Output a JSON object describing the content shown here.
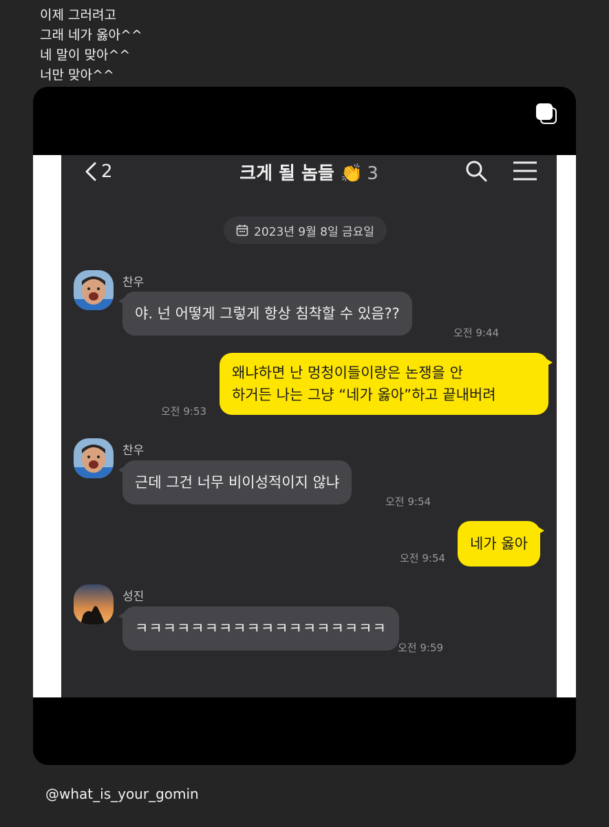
{
  "caption": {
    "lines": [
      "이제 그러려고",
      "그래 네가 옳아^^",
      "네 말이 맞아^^",
      "너만 맞아^^"
    ]
  },
  "chat": {
    "back_count": "2",
    "title": "크게 될 놈들 👏",
    "member_count": "3",
    "date": "2023년 9월 8일 금요일",
    "messages": [
      {
        "sender": "찬우",
        "text": "야. 넌 어떻게 그렇게 항상 침착할 수 있음??",
        "time": "오전 9:44",
        "direction": "in"
      },
      {
        "text_line1": "왜냐하면 난 멍청이들이랑은 논쟁을 안",
        "text_line2": "하거든 나는 그냥 “네가 옳아”하고 끝내버려",
        "time": "오전 9:53",
        "direction": "out"
      },
      {
        "sender": "찬우",
        "text": "근데 그건 너무 비이성적이지 않냐",
        "time": "오전 9:54",
        "direction": "in"
      },
      {
        "text": "네가 옳아",
        "time": "오전 9:54",
        "direction": "out"
      },
      {
        "sender": "성진",
        "text": "ㅋㅋㅋㅋㅋㅋㅋㅋㅋㅋㅋㅋㅋㅋㅋㅋㅋㅋ",
        "time": "오전 9:59",
        "direction": "in"
      }
    ]
  },
  "handle": "@what_is_your_gomin",
  "icons": [
    "multiple-posts-icon",
    "back-chevron-icon",
    "clap-emoji",
    "search-icon",
    "menu-icon",
    "calendar-icon"
  ],
  "colors": {
    "bubble_out": "#fee500",
    "bubble_in": "#45454a",
    "chat_bg": "#2a2a2d"
  }
}
